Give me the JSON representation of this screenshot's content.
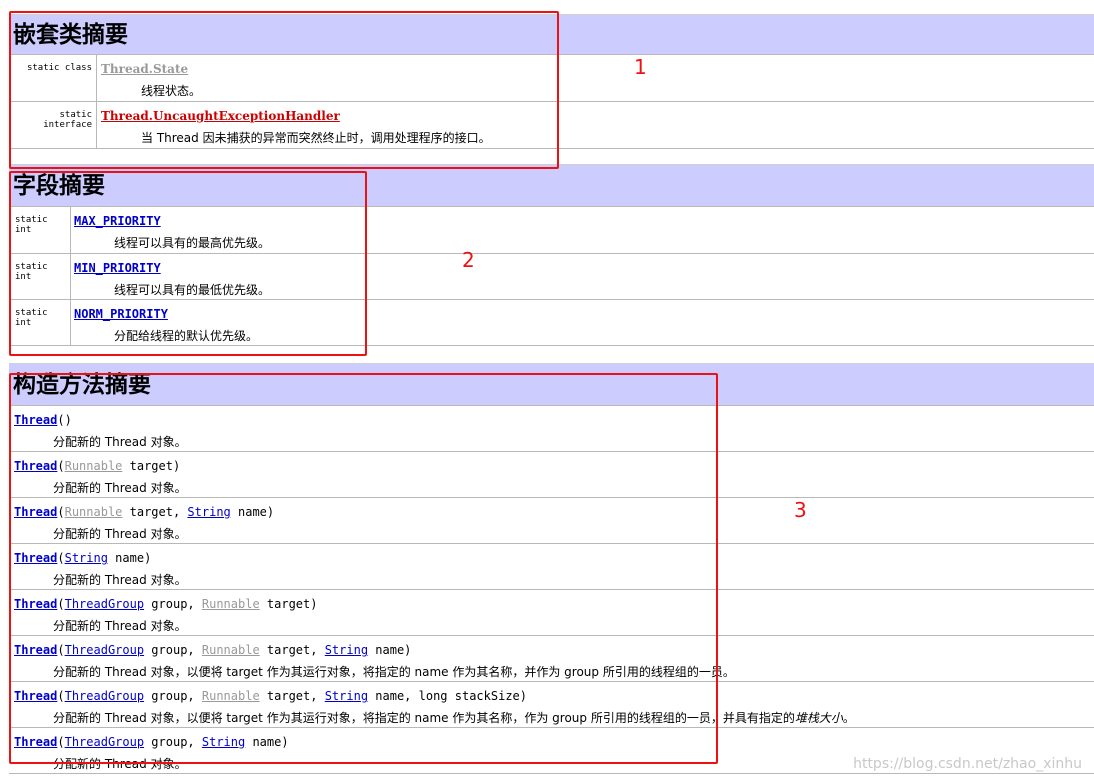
{
  "nested": {
    "title": "嵌套类摘要",
    "rows": [
      {
        "modifier": "static class",
        "name": "Thread.State",
        "desc": "线程状态。"
      },
      {
        "modifier": "static interface",
        "name": "Thread.UncaughtExceptionHandler",
        "desc": "当 Thread 因未捕获的异常而突然终止时，调用处理程序的接口。"
      }
    ]
  },
  "fields": {
    "title": "字段摘要",
    "rows": [
      {
        "modifier": "static int",
        "name": "MAX_PRIORITY",
        "desc": "线程可以具有的最高优先级。"
      },
      {
        "modifier": "static int",
        "name": "MIN_PRIORITY",
        "desc": "线程可以具有的最低优先级。"
      },
      {
        "modifier": "static int",
        "name": "NORM_PRIORITY",
        "desc": "分配给线程的默认优先级。"
      }
    ]
  },
  "constructors": {
    "title": "构造方法摘要",
    "rows": [
      {
        "sig": {
          "name": "Thread",
          "open": "()"
        },
        "desc": "分配新的 Thread 对象。"
      },
      {
        "sig": {
          "name": "Thread",
          "open": "(",
          "t1": "Runnable",
          "p1": " target)"
        },
        "desc": "分配新的 Thread 对象。"
      },
      {
        "sig": {
          "name": "Thread",
          "open": "(",
          "t1": "Runnable",
          "p1": " target, ",
          "t2": "String",
          "p2": " name)"
        },
        "desc": "分配新的 Thread 对象。"
      },
      {
        "sig": {
          "name": "Thread",
          "open": "(",
          "t1": "String",
          "p1": " name)"
        },
        "desc": "分配新的 Thread 对象。"
      },
      {
        "sig": {
          "name": "Thread",
          "open": "(",
          "t1": "ThreadGroup",
          "p1": " group, ",
          "t2": "Runnable",
          "p2": " target)"
        },
        "desc": "分配新的 Thread 对象。"
      },
      {
        "sig": {
          "name": "Thread",
          "open": "(",
          "t1": "ThreadGroup",
          "p1": " group, ",
          "t2": "Runnable",
          "p2": " target, ",
          "t3": "String",
          "p3": " name)"
        },
        "desc": "分配新的 Thread 对象，以便将 target 作为其运行对象，将指定的 name 作为其名称，并作为 group 所引用的线程组的一员。"
      },
      {
        "sig": {
          "name": "Thread",
          "open": "(",
          "t1": "ThreadGroup",
          "p1": " group, ",
          "t2": "Runnable",
          "p2": " target, ",
          "t3": "String",
          "p3": " name, long stackSize)"
        },
        "desc": "分配新的 Thread 对象，以便将 target 作为其运行对象，将指定的 name 作为其名称，作为 group 所引用的线程组的一员，并具有指定的",
        "desc_em": "堆栈大小",
        "desc_end": "。"
      },
      {
        "sig": {
          "name": "Thread",
          "open": "(",
          "t1": "ThreadGroup",
          "p1": " group, ",
          "t2": "String",
          "p2": " name)"
        },
        "desc": "分配新的 Thread 对象。"
      }
    ]
  },
  "annotations": [
    "1",
    "2",
    "3"
  ],
  "watermark": "https://blog.csdn.net/zhao_xinhu",
  "colors": {
    "header_bg": "#ccccff",
    "link": "#0000cc",
    "annotation": "#ee1111"
  }
}
